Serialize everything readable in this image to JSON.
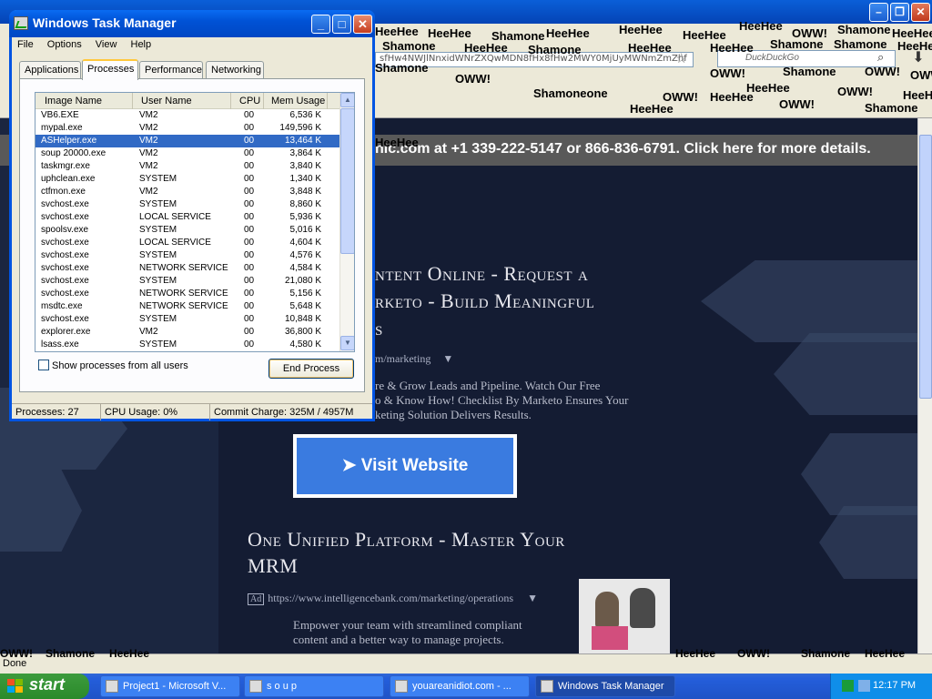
{
  "browser": {
    "address_fragment": "sfHw4NWJlNnxidWNrZXQwMDN8fHx8fHw2MWY0MjUyMWNmZmZhf",
    "search_placeholder": "DuckDuckGo",
    "banner_text": "nic.com at +1 339-222-5147 or 866-836-6791. Click here for more details.",
    "status_text": "Done",
    "ads": [
      {
        "title_line1": "ntent Online - Request a",
        "title_line2": "rketo - Build Meaningful",
        "title_line3": "s",
        "url": "m/marketing",
        "desc_line1": "re & Grow Leads and Pipeline. Watch Our Free",
        "desc_line2": "o & Know How! Checklist By Marketo Ensures Your",
        "desc_line3": "keting Solution Delivers Results."
      },
      {
        "title_line1": "One Unified Platform - Master Your",
        "title_line2": "MRM",
        "ad_badge": "Ad",
        "url": "https://www.intelligencebank.com/marketing/operations",
        "desc_line1": "Empower your team with streamlined compliant",
        "desc_line2": "content and a better way to manage projects."
      }
    ],
    "visit_button": "➤  Visit Website",
    "spam_words": [
      "HeeHee",
      "Shamone",
      "OWW!",
      "one",
      "Shamoneone"
    ]
  },
  "task_manager": {
    "title": "Windows Task Manager",
    "menu": [
      "File",
      "Options",
      "View",
      "Help"
    ],
    "tabs": [
      "Applications",
      "Processes",
      "Performance",
      "Networking"
    ],
    "selected_tab": "Processes",
    "columns": [
      "Image Name",
      "User Name",
      "CPU",
      "Mem Usage"
    ],
    "processes": [
      {
        "name": "VB6.EXE",
        "user": "VM2",
        "cpu": "00",
        "mem": "6,536 K"
      },
      {
        "name": "mypal.exe",
        "user": "VM2",
        "cpu": "00",
        "mem": "149,596 K"
      },
      {
        "name": "ASHelper.exe",
        "user": "VM2",
        "cpu": "00",
        "mem": "13,464 K"
      },
      {
        "name": "soup 20000.exe",
        "user": "VM2",
        "cpu": "00",
        "mem": "3,864 K"
      },
      {
        "name": "taskmgr.exe",
        "user": "VM2",
        "cpu": "00",
        "mem": "3,840 K"
      },
      {
        "name": "uphclean.exe",
        "user": "SYSTEM",
        "cpu": "00",
        "mem": "1,340 K"
      },
      {
        "name": "ctfmon.exe",
        "user": "VM2",
        "cpu": "00",
        "mem": "3,848 K"
      },
      {
        "name": "svchost.exe",
        "user": "SYSTEM",
        "cpu": "00",
        "mem": "8,860 K"
      },
      {
        "name": "svchost.exe",
        "user": "LOCAL SERVICE",
        "cpu": "00",
        "mem": "5,936 K"
      },
      {
        "name": "spoolsv.exe",
        "user": "SYSTEM",
        "cpu": "00",
        "mem": "5,016 K"
      },
      {
        "name": "svchost.exe",
        "user": "LOCAL SERVICE",
        "cpu": "00",
        "mem": "4,604 K"
      },
      {
        "name": "svchost.exe",
        "user": "SYSTEM",
        "cpu": "00",
        "mem": "4,576 K"
      },
      {
        "name": "svchost.exe",
        "user": "NETWORK SERVICE",
        "cpu": "00",
        "mem": "4,584 K"
      },
      {
        "name": "svchost.exe",
        "user": "SYSTEM",
        "cpu": "00",
        "mem": "21,080 K"
      },
      {
        "name": "svchost.exe",
        "user": "NETWORK SERVICE",
        "cpu": "00",
        "mem": "5,156 K"
      },
      {
        "name": "msdtc.exe",
        "user": "NETWORK SERVICE",
        "cpu": "00",
        "mem": "5,648 K"
      },
      {
        "name": "svchost.exe",
        "user": "SYSTEM",
        "cpu": "00",
        "mem": "10,848 K"
      },
      {
        "name": "explorer.exe",
        "user": "VM2",
        "cpu": "00",
        "mem": "36,800 K"
      },
      {
        "name": "lsass.exe",
        "user": "SYSTEM",
        "cpu": "00",
        "mem": "4,580 K"
      }
    ],
    "selected_process": "ASHelper.exe",
    "show_all_label": "Show processes from all users",
    "end_process_label": "End Process",
    "status": {
      "processes": "Processes: 27",
      "cpu": "CPU Usage: 0%",
      "commit": "Commit Charge: 325M / 4957M"
    }
  },
  "taskbar": {
    "start_label": "start",
    "buttons": [
      "Project1 - Microsoft V...",
      "s o u p",
      "youareanidiot.com - ...",
      "Windows Task Manager"
    ],
    "active_button": "Windows Task Manager",
    "clock": "12:17 PM"
  },
  "colors": {
    "xp_blue": "#0054e3",
    "selection": "#316ac5",
    "page_navy": "#1b2640",
    "visit_blue": "#3a7be0"
  }
}
